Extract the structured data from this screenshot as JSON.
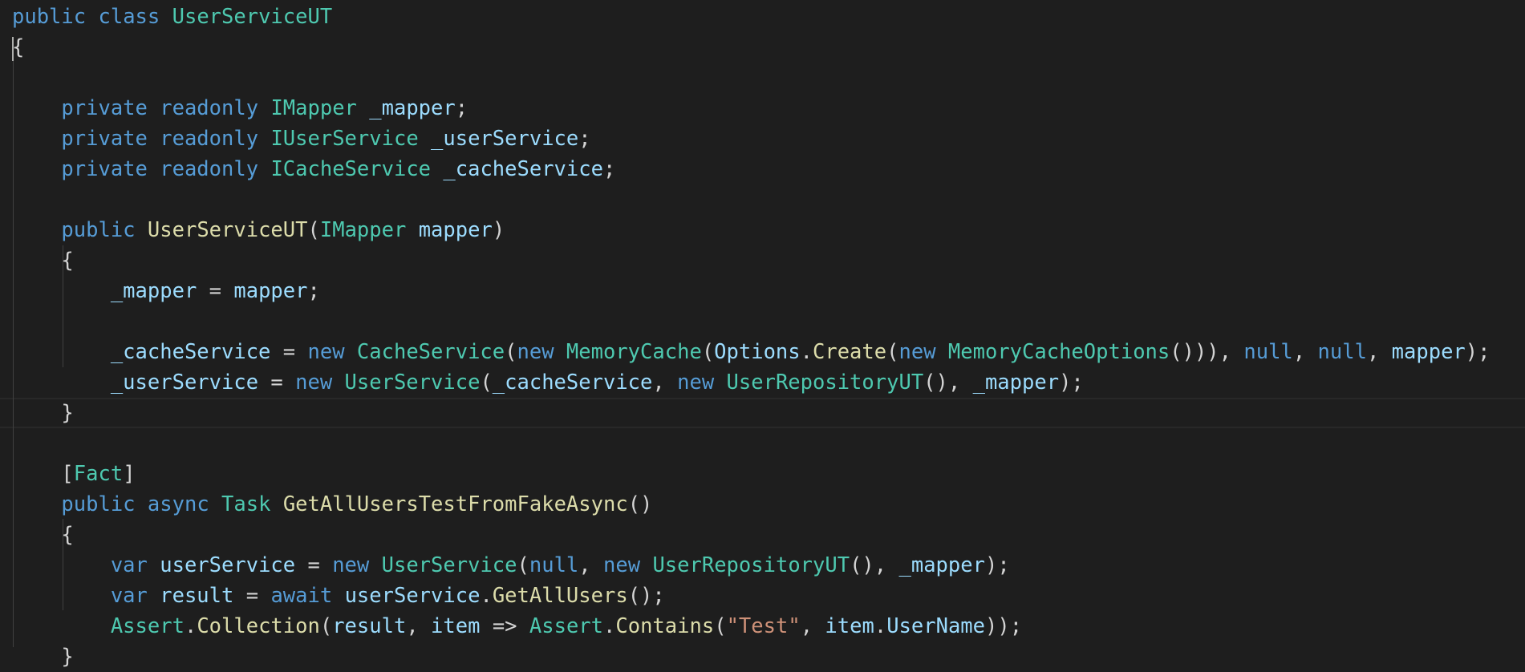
{
  "editor": {
    "language": "C#",
    "theme": "Dark+",
    "colors": {
      "background": "#1e1e1e",
      "keyword": "#569cd6",
      "type": "#4ec9b0",
      "function": "#dcdcaa",
      "variable": "#9cdcfe",
      "plain": "#d4d4d4",
      "string": "#ce9178"
    },
    "lines": [
      [
        {
          "t": "public",
          "c": "kw"
        },
        {
          "t": " ",
          "c": "pl"
        },
        {
          "t": "class",
          "c": "kw"
        },
        {
          "t": " ",
          "c": "pl"
        },
        {
          "t": "UserServiceUT",
          "c": "ty"
        }
      ],
      [
        {
          "t": "{",
          "c": "pl"
        }
      ],
      [],
      [
        {
          "t": "    ",
          "c": "pl"
        },
        {
          "t": "private",
          "c": "kw"
        },
        {
          "t": " ",
          "c": "pl"
        },
        {
          "t": "readonly",
          "c": "kw"
        },
        {
          "t": " ",
          "c": "pl"
        },
        {
          "t": "IMapper",
          "c": "ty"
        },
        {
          "t": " ",
          "c": "pl"
        },
        {
          "t": "_mapper",
          "c": "var"
        },
        {
          "t": ";",
          "c": "pl"
        }
      ],
      [
        {
          "t": "    ",
          "c": "pl"
        },
        {
          "t": "private",
          "c": "kw"
        },
        {
          "t": " ",
          "c": "pl"
        },
        {
          "t": "readonly",
          "c": "kw"
        },
        {
          "t": " ",
          "c": "pl"
        },
        {
          "t": "IUserService",
          "c": "ty"
        },
        {
          "t": " ",
          "c": "pl"
        },
        {
          "t": "_userService",
          "c": "var"
        },
        {
          "t": ";",
          "c": "pl"
        }
      ],
      [
        {
          "t": "    ",
          "c": "pl"
        },
        {
          "t": "private",
          "c": "kw"
        },
        {
          "t": " ",
          "c": "pl"
        },
        {
          "t": "readonly",
          "c": "kw"
        },
        {
          "t": " ",
          "c": "pl"
        },
        {
          "t": "ICacheService",
          "c": "ty"
        },
        {
          "t": " ",
          "c": "pl"
        },
        {
          "t": "_cacheService",
          "c": "var"
        },
        {
          "t": ";",
          "c": "pl"
        }
      ],
      [],
      [
        {
          "t": "    ",
          "c": "pl"
        },
        {
          "t": "public",
          "c": "kw"
        },
        {
          "t": " ",
          "c": "pl"
        },
        {
          "t": "UserServiceUT",
          "c": "fn"
        },
        {
          "t": "(",
          "c": "pl"
        },
        {
          "t": "IMapper",
          "c": "ty"
        },
        {
          "t": " ",
          "c": "pl"
        },
        {
          "t": "mapper",
          "c": "var"
        },
        {
          "t": ")",
          "c": "pl"
        }
      ],
      [
        {
          "t": "    {",
          "c": "pl"
        }
      ],
      [
        {
          "t": "        ",
          "c": "pl"
        },
        {
          "t": "_mapper",
          "c": "var"
        },
        {
          "t": " = ",
          "c": "pl"
        },
        {
          "t": "mapper",
          "c": "var"
        },
        {
          "t": ";",
          "c": "pl"
        }
      ],
      [],
      [
        {
          "t": "        ",
          "c": "pl"
        },
        {
          "t": "_cacheService",
          "c": "var"
        },
        {
          "t": " = ",
          "c": "pl"
        },
        {
          "t": "new",
          "c": "kw"
        },
        {
          "t": " ",
          "c": "pl"
        },
        {
          "t": "CacheService",
          "c": "ty"
        },
        {
          "t": "(",
          "c": "pl"
        },
        {
          "t": "new",
          "c": "kw"
        },
        {
          "t": " ",
          "c": "pl"
        },
        {
          "t": "MemoryCache",
          "c": "ty"
        },
        {
          "t": "(",
          "c": "pl"
        },
        {
          "t": "Options",
          "c": "var"
        },
        {
          "t": ".",
          "c": "pl"
        },
        {
          "t": "Create",
          "c": "fn"
        },
        {
          "t": "(",
          "c": "pl"
        },
        {
          "t": "new",
          "c": "kw"
        },
        {
          "t": " ",
          "c": "pl"
        },
        {
          "t": "MemoryCacheOptions",
          "c": "ty"
        },
        {
          "t": "())), ",
          "c": "pl"
        },
        {
          "t": "null",
          "c": "kw"
        },
        {
          "t": ", ",
          "c": "pl"
        },
        {
          "t": "null",
          "c": "kw"
        },
        {
          "t": ", ",
          "c": "pl"
        },
        {
          "t": "mapper",
          "c": "var"
        },
        {
          "t": ");",
          "c": "pl"
        }
      ],
      [
        {
          "t": "        ",
          "c": "pl"
        },
        {
          "t": "_userService",
          "c": "var"
        },
        {
          "t": " = ",
          "c": "pl"
        },
        {
          "t": "new",
          "c": "kw"
        },
        {
          "t": " ",
          "c": "pl"
        },
        {
          "t": "UserService",
          "c": "ty"
        },
        {
          "t": "(",
          "c": "pl"
        },
        {
          "t": "_cacheService",
          "c": "var"
        },
        {
          "t": ", ",
          "c": "pl"
        },
        {
          "t": "new",
          "c": "kw"
        },
        {
          "t": " ",
          "c": "pl"
        },
        {
          "t": "UserRepositoryUT",
          "c": "ty"
        },
        {
          "t": "(), ",
          "c": "pl"
        },
        {
          "t": "_mapper",
          "c": "var"
        },
        {
          "t": ");",
          "c": "pl"
        }
      ],
      [
        {
          "t": "    }",
          "c": "pl"
        }
      ],
      [],
      [
        {
          "t": "    [",
          "c": "pl"
        },
        {
          "t": "Fact",
          "c": "ty"
        },
        {
          "t": "]",
          "c": "pl"
        }
      ],
      [
        {
          "t": "    ",
          "c": "pl"
        },
        {
          "t": "public",
          "c": "kw"
        },
        {
          "t": " ",
          "c": "pl"
        },
        {
          "t": "async",
          "c": "kw"
        },
        {
          "t": " ",
          "c": "pl"
        },
        {
          "t": "Task",
          "c": "ty"
        },
        {
          "t": " ",
          "c": "pl"
        },
        {
          "t": "GetAllUsersTestFromFakeAsync",
          "c": "fn"
        },
        {
          "t": "()",
          "c": "pl"
        }
      ],
      [
        {
          "t": "    {",
          "c": "pl"
        }
      ],
      [
        {
          "t": "        ",
          "c": "pl"
        },
        {
          "t": "var",
          "c": "kw"
        },
        {
          "t": " ",
          "c": "pl"
        },
        {
          "t": "userService",
          "c": "var"
        },
        {
          "t": " = ",
          "c": "pl"
        },
        {
          "t": "new",
          "c": "kw"
        },
        {
          "t": " ",
          "c": "pl"
        },
        {
          "t": "UserService",
          "c": "ty"
        },
        {
          "t": "(",
          "c": "pl"
        },
        {
          "t": "null",
          "c": "kw"
        },
        {
          "t": ", ",
          "c": "pl"
        },
        {
          "t": "new",
          "c": "kw"
        },
        {
          "t": " ",
          "c": "pl"
        },
        {
          "t": "UserRepositoryUT",
          "c": "ty"
        },
        {
          "t": "(), ",
          "c": "pl"
        },
        {
          "t": "_mapper",
          "c": "var"
        },
        {
          "t": ");",
          "c": "pl"
        }
      ],
      [
        {
          "t": "        ",
          "c": "pl"
        },
        {
          "t": "var",
          "c": "kw"
        },
        {
          "t": " ",
          "c": "pl"
        },
        {
          "t": "result",
          "c": "var"
        },
        {
          "t": " = ",
          "c": "pl"
        },
        {
          "t": "await",
          "c": "kw"
        },
        {
          "t": " ",
          "c": "pl"
        },
        {
          "t": "userService",
          "c": "var"
        },
        {
          "t": ".",
          "c": "pl"
        },
        {
          "t": "GetAllUsers",
          "c": "fn"
        },
        {
          "t": "();",
          "c": "pl"
        }
      ],
      [
        {
          "t": "        ",
          "c": "pl"
        },
        {
          "t": "Assert",
          "c": "ty"
        },
        {
          "t": ".",
          "c": "pl"
        },
        {
          "t": "Collection",
          "c": "fn"
        },
        {
          "t": "(",
          "c": "pl"
        },
        {
          "t": "result",
          "c": "var"
        },
        {
          "t": ", ",
          "c": "pl"
        },
        {
          "t": "item",
          "c": "var"
        },
        {
          "t": " => ",
          "c": "pl"
        },
        {
          "t": "Assert",
          "c": "ty"
        },
        {
          "t": ".",
          "c": "pl"
        },
        {
          "t": "Contains",
          "c": "fn"
        },
        {
          "t": "(",
          "c": "pl"
        },
        {
          "t": "\"Test\"",
          "c": "str"
        },
        {
          "t": ", ",
          "c": "pl"
        },
        {
          "t": "item",
          "c": "var"
        },
        {
          "t": ".",
          "c": "pl"
        },
        {
          "t": "UserName",
          "c": "var"
        },
        {
          "t": "));",
          "c": "pl"
        }
      ],
      [
        {
          "t": "    }",
          "c": "pl"
        }
      ]
    ]
  }
}
